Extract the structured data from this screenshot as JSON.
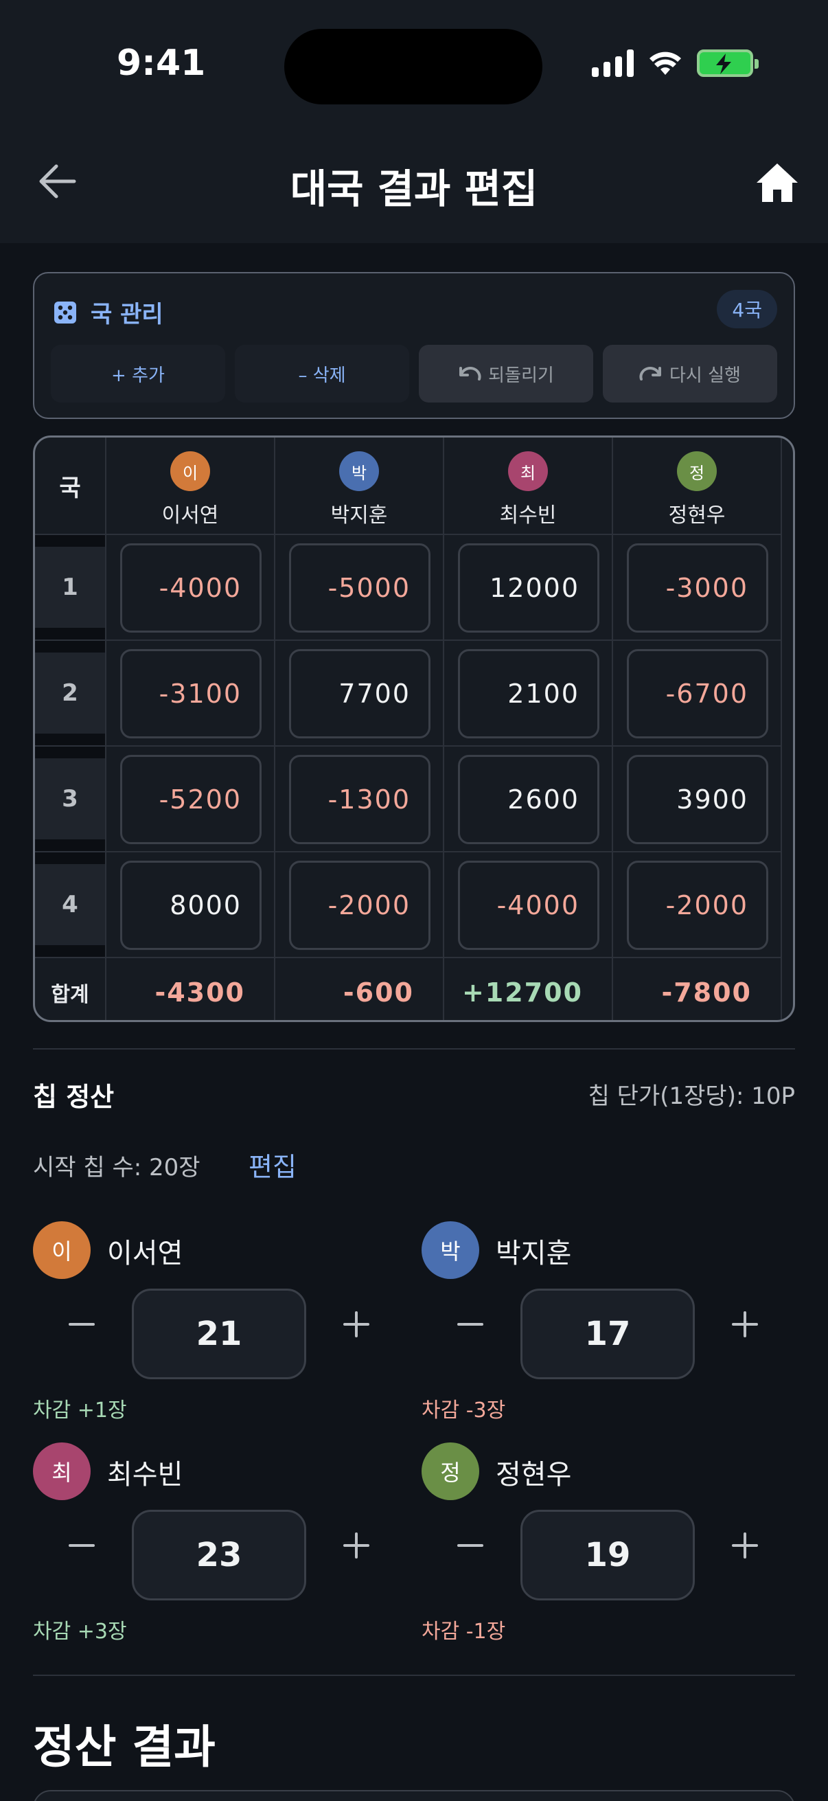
{
  "status": {
    "time": "9:41"
  },
  "header": {
    "title": "대국 결과 편집"
  },
  "rounds": {
    "title": "국 관리",
    "badge": "4국",
    "add": "+ 추가",
    "delete": "– 삭제",
    "undo": "되돌리기",
    "redo": "다시 실행"
  },
  "table": {
    "round_header": "국",
    "total_label": "합계",
    "players": [
      {
        "initial": "이",
        "name": "이서연",
        "color": "#d27a3a"
      },
      {
        "initial": "박",
        "name": "박지훈",
        "color": "#4a6fb0"
      },
      {
        "initial": "최",
        "name": "최수빈",
        "color": "#a8456e"
      },
      {
        "initial": "정",
        "name": "정현우",
        "color": "#6a8f46"
      }
    ],
    "rows": [
      {
        "round": "1",
        "scores": [
          "-4000",
          "-5000",
          "12000",
          "-3000"
        ]
      },
      {
        "round": "2",
        "scores": [
          "-3100",
          "7700",
          "2100",
          "-6700"
        ]
      },
      {
        "round": "3",
        "scores": [
          "-5200",
          "-1300",
          "2600",
          "3900"
        ]
      },
      {
        "round": "4",
        "scores": [
          "8000",
          "-2000",
          "-4000",
          "-2000"
        ]
      }
    ],
    "totals": [
      "-4300",
      "-600",
      "+12700",
      "-7800"
    ]
  },
  "chips": {
    "title": "칩 정산",
    "unit_price": "칩 단가(1장당): 10P",
    "start": "시작 칩 수: 20장",
    "edit": "편집",
    "players": [
      {
        "initial": "이",
        "name": "이서연",
        "count": "21",
        "diff": "차감 +1장",
        "color": "#d27a3a",
        "positive": true
      },
      {
        "initial": "박",
        "name": "박지훈",
        "count": "17",
        "diff": "차감 -3장",
        "color": "#4a6fb0",
        "positive": false
      },
      {
        "initial": "최",
        "name": "최수빈",
        "count": "23",
        "diff": "차감 +3장",
        "color": "#a8456e",
        "positive": true
      },
      {
        "initial": "정",
        "name": "정현우",
        "count": "19",
        "diff": "차감 -1장",
        "color": "#6a8f46",
        "positive": false
      }
    ]
  },
  "result": {
    "title": "정산 결과"
  }
}
